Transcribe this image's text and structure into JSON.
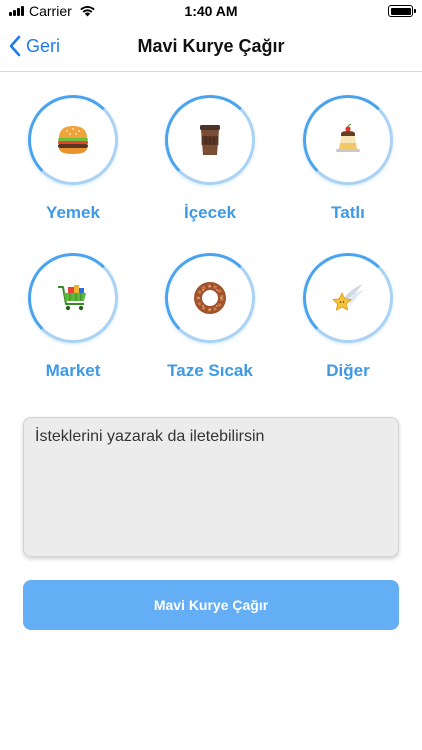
{
  "status_bar": {
    "carrier": "Carrier",
    "time": "1:40 AM"
  },
  "nav": {
    "back_label": "Geri",
    "title": "Mavi Kurye Çağır"
  },
  "categories": [
    {
      "label": "Yemek",
      "icon": "burger-icon"
    },
    {
      "label": "İçecek",
      "icon": "coffee-cup-icon"
    },
    {
      "label": "Tatlı",
      "icon": "pudding-icon"
    },
    {
      "label": "Market",
      "icon": "shopping-cart-icon"
    },
    {
      "label": "Taze Sıcak",
      "icon": "simit-icon"
    },
    {
      "label": "Diğer",
      "icon": "shooting-star-icon"
    }
  ],
  "request": {
    "placeholder": "İsteklerini yazarak da iletebilirsin"
  },
  "submit": {
    "label": "Mavi Kurye Çağır"
  },
  "colors": {
    "accent_blue": "#3d9ae8",
    "button_blue": "#64aef6",
    "nav_blue": "#1e7cf0"
  }
}
